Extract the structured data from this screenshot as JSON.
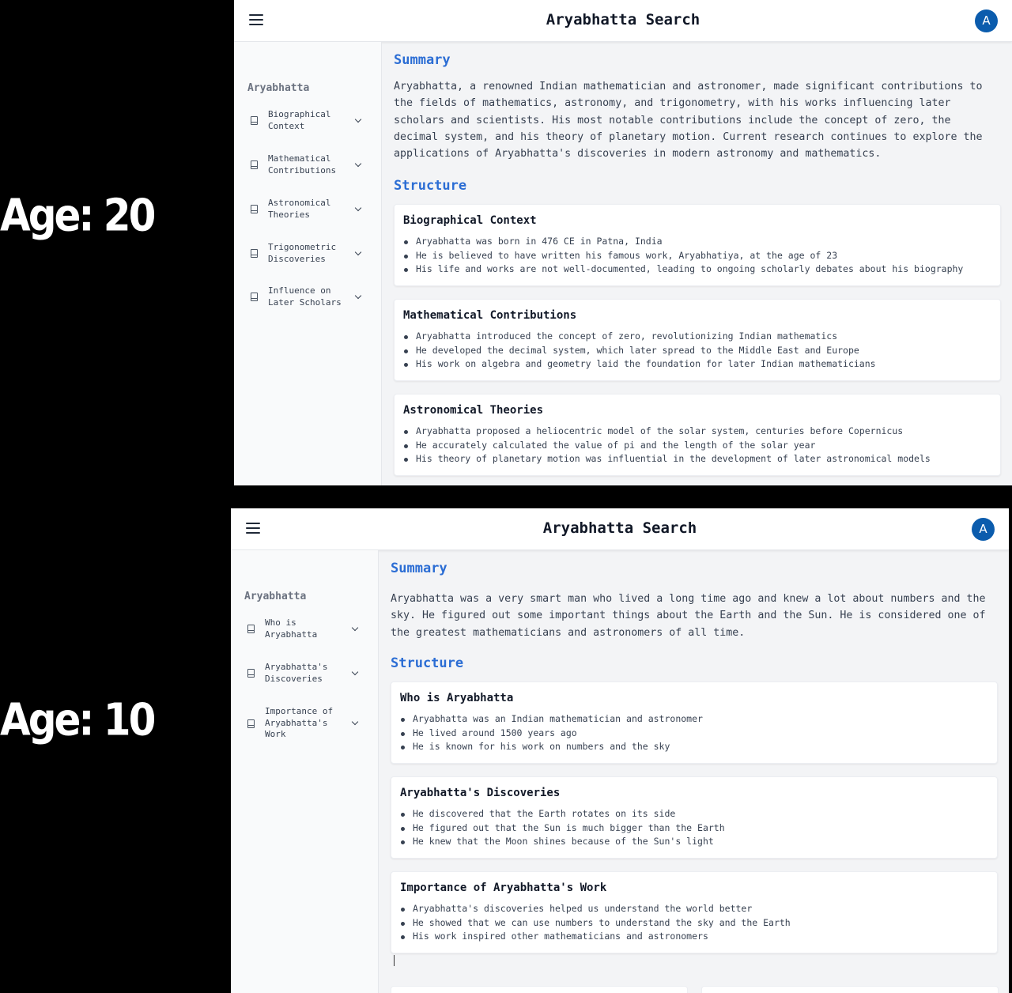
{
  "panels": [
    {
      "age_label": "Age: 20",
      "app_title": "Aryabhatta Search",
      "avatar_letter": "A",
      "sidebar": {
        "title": "Aryabhatta",
        "items": [
          {
            "label": "Biographical Context"
          },
          {
            "label": "Mathematical Contributions"
          },
          {
            "label": "Astronomical Theories"
          },
          {
            "label": "Trigonometric Discoveries"
          },
          {
            "label": "Influence on Later Scholars"
          }
        ]
      },
      "summary_heading": "Summary",
      "summary_text": "Aryabhatta, a renowned Indian mathematician and astronomer, made significant contributions to the fields of mathematics, astronomy, and trigonometry, with his works influencing later scholars and scientists. His most notable contributions include the concept of zero, the decimal system, and his theory of planetary motion. Current research continues to explore the applications of Aryabhatta's discoveries in modern astronomy and mathematics.",
      "structure_heading": "Structure",
      "cards": [
        {
          "title": "Biographical Context",
          "bullets": [
            "Aryabhatta was born in 476 CE in Patna, India",
            "He is believed to have written his famous work, Aryabhatiya, at the age of 23",
            "His life and works are not well-documented, leading to ongoing scholarly debates about his biography"
          ]
        },
        {
          "title": "Mathematical Contributions",
          "bullets": [
            "Aryabhatta introduced the concept of zero, revolutionizing Indian mathematics",
            "He developed the decimal system, which later spread to the Middle East and Europe",
            "His work on algebra and geometry laid the foundation for later Indian mathematicians"
          ]
        },
        {
          "title": "Astronomical Theories",
          "bullets": [
            "Aryabhatta proposed a heliocentric model of the solar system, centuries before Copernicus",
            "He accurately calculated the value of pi and the length of the solar year",
            "His theory of planetary motion was influential in the development of later astronomical models"
          ]
        }
      ]
    },
    {
      "age_label": "Age: 10",
      "app_title": "Aryabhatta Search",
      "avatar_letter": "A",
      "sidebar": {
        "title": "Aryabhatta",
        "items": [
          {
            "label": "Who is Aryabhatta"
          },
          {
            "label": "Aryabhatta's Discoveries"
          },
          {
            "label": "Importance of Aryabhatta's Work"
          }
        ]
      },
      "summary_heading": "Summary",
      "summary_text": "Aryabhatta was a very smart man who lived a long time ago and knew a lot about numbers and the sky. He figured out some important things about the Earth and the Sun. He is considered one of the greatest mathematicians and astronomers of all time.",
      "structure_heading": "Structure",
      "cards": [
        {
          "title": "Who is Aryabhatta",
          "bullets": [
            "Aryabhatta was an Indian mathematician and astronomer",
            "He lived around 1500 years ago",
            "He is known for his work on numbers and the sky"
          ]
        },
        {
          "title": "Aryabhatta's Discoveries",
          "bullets": [
            "He discovered that the Earth rotates on its side",
            "He figured out that the Sun is much bigger than the Earth",
            "He knew that the Moon shines because of the Sun's light"
          ]
        },
        {
          "title": "Importance of Aryabhatta's Work",
          "bullets": [
            "Aryabhatta's discoveries helped us understand the world better",
            "He showed that we can use numbers to understand the sky and the Earth",
            "His work inspired other mathematicians and astronomers"
          ]
        }
      ]
    }
  ]
}
